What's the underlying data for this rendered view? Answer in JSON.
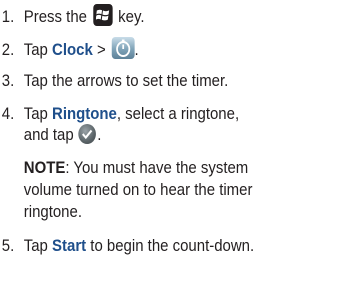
{
  "steps": [
    {
      "num": "1.",
      "pre": "Press the",
      "post": " key."
    },
    {
      "num": "2.",
      "pre": "Tap ",
      "keyword": "Clock",
      "sep": " > ",
      "post": "."
    },
    {
      "num": "3.",
      "text": "Tap the arrows to set the timer."
    },
    {
      "num": "4.",
      "pre": "Tap ",
      "keyword": "Ringtone",
      "mid": ", select a ringtone,",
      "line2_pre": "and tap ",
      "line2_post": "."
    },
    {
      "num": "5.",
      "pre": "Tap ",
      "keyword": "Start",
      "post": " to begin the count-down."
    }
  ],
  "note": {
    "label": "NOTE",
    "line1": ": You must have the system",
    "line2": "volume turned on to hear the timer",
    "line3": "ringtone."
  },
  "icons": {
    "step1": "windows-key-icon",
    "step2": "timer-icon",
    "step4": "ok-button-icon"
  },
  "colors": {
    "keyword": "#1f4f8b",
    "text": "#231f20"
  }
}
